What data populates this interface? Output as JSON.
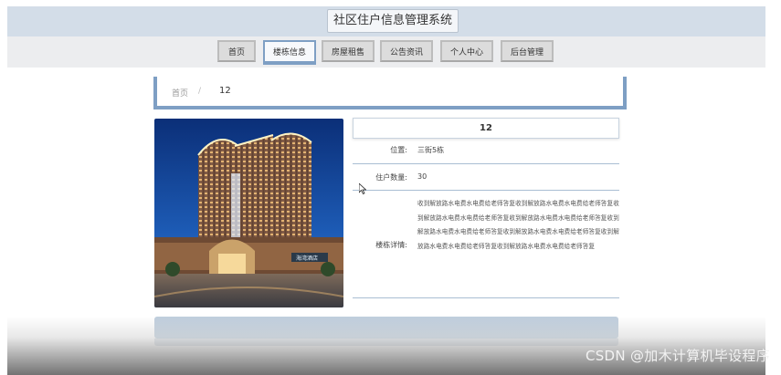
{
  "header": {
    "site_title": "社区住户信息管理系统"
  },
  "nav": {
    "items": [
      {
        "label": "首页"
      },
      {
        "label": "楼栋信息",
        "active": true
      },
      {
        "label": "房屋租售"
      },
      {
        "label": "公告资讯"
      },
      {
        "label": "个人中心"
      },
      {
        "label": "后台管理"
      }
    ]
  },
  "breadcrumb": {
    "home": "首页",
    "separator": "/",
    "current": "12"
  },
  "building": {
    "name": "12",
    "location_label": "位置:",
    "location_value": "三街5栋",
    "households_label": "住户数量:",
    "households_value": "30",
    "detail_label": "楼栋详情:",
    "detail_value": "收到解放路水电费水电费给老师答复收到解放路水电费水电费给老师答复收到解放路水电费水电费给老师答复收到解放路水电费水电费给老师答复收到解放路水电费水电费给老师答复收到解放路水电费水电费给老师答复收到解放路水电费水电费给老师答复收到解放路水电费水电费给老师答复"
  },
  "photo": {
    "sign_text": "海湾酒店"
  },
  "watermark": "CSDN @加木计算机毕设程序",
  "colors": {
    "accent": "#7e9fc4",
    "topbar": "#d3dde8"
  }
}
